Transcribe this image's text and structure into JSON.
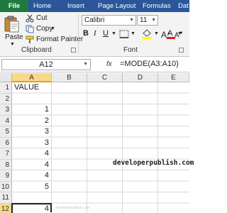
{
  "tabs": {
    "file": "File",
    "home": "Home",
    "insert": "Insert",
    "page_layout": "Page Layout",
    "formulas": "Formulas",
    "data": "Dat"
  },
  "clipboard": {
    "paste": "Paste",
    "cut": "Cut",
    "copy": "Copy",
    "format_painter": "Format Painter",
    "group_label": "Clipboard"
  },
  "font": {
    "family": "Calibri",
    "size": "11",
    "group_label": "Font",
    "bold": "B",
    "italic": "I",
    "underline": "U"
  },
  "formula_bar": {
    "name_box": "A12",
    "fx": "fx",
    "formula": "=MODE(A3:A10)"
  },
  "columns": [
    "A",
    "B",
    "C",
    "D",
    "E"
  ],
  "rows": [
    "1",
    "2",
    "3",
    "4",
    "5",
    "6",
    "7",
    "8",
    "9",
    "10",
    "11",
    "12"
  ],
  "cells": {
    "A1": "VALUE",
    "A3": "1",
    "A4": "2",
    "A5": "3",
    "A6": "3",
    "A7": "4",
    "A8": "4",
    "A9": "4",
    "A10": "5",
    "A12": "4"
  },
  "watermark": "developerpublish.com",
  "footer": "developerpublish.com"
}
